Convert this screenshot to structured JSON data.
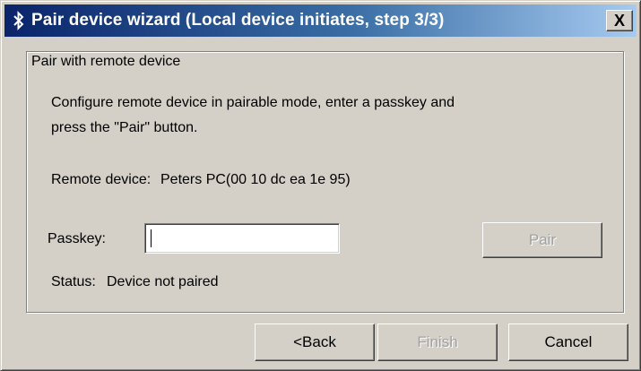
{
  "window": {
    "title": "Pair device wizard (Local device initiates, step 3/3)",
    "close_label": "X",
    "title_icon": "bluetooth-icon",
    "colors": {
      "titlebar_start": "#0a246a",
      "titlebar_end": "#a6caf0",
      "face": "#d4d0c8",
      "disabled_text": "#a0a0a0"
    }
  },
  "group": {
    "label": "Pair with remote device",
    "instructions_line1": "Configure remote device in pairable mode, enter a passkey and",
    "instructions_line2": "press the \"Pair\" button.",
    "remote_device_label": "Remote device:",
    "remote_device_value": "Peters PC(00 10 dc ea 1e 95)",
    "passkey_label": "Passkey:",
    "passkey_value": "",
    "pair_button": "Pair",
    "status_label": "Status:",
    "status_value": "Device not paired"
  },
  "footer": {
    "back_button": "<Back",
    "finish_button": "Finish",
    "cancel_button": "Cancel"
  }
}
